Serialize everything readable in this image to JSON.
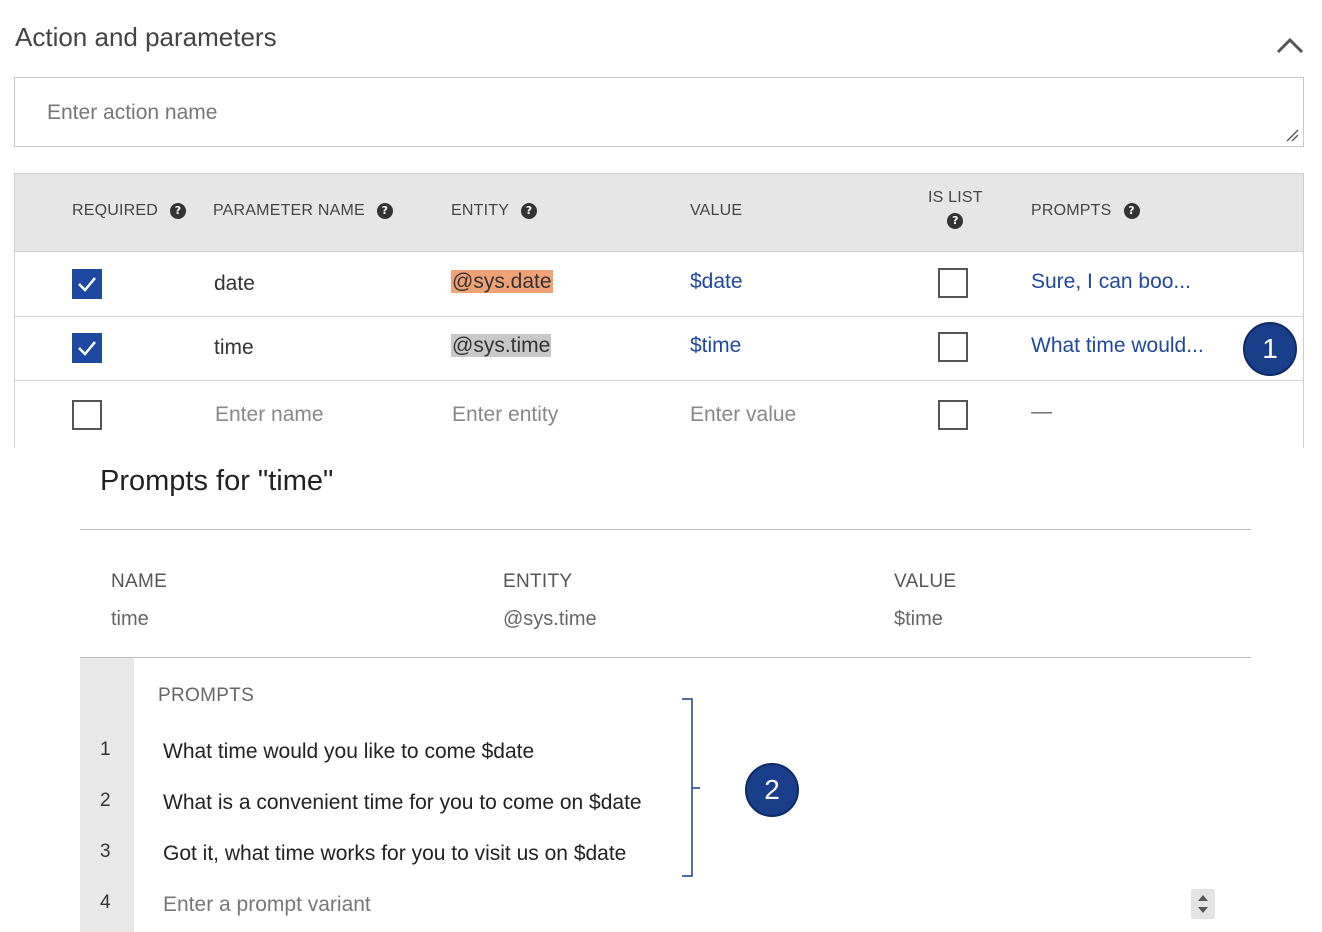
{
  "section": {
    "title": "Action and parameters",
    "collapse_icon": "chevron-up-icon"
  },
  "action_input": {
    "placeholder": "Enter action name"
  },
  "params_table": {
    "headers": {
      "required": "REQUIRED",
      "parameter_name": "PARAMETER NAME",
      "entity": "ENTITY",
      "value": "VALUE",
      "is_list_line1": "IS LIST",
      "prompts": "PROMPTS"
    },
    "help_icon": "?",
    "rows": [
      {
        "required": true,
        "name": "date",
        "entity": "@sys.date",
        "value": "$date",
        "is_list": false,
        "prompts": "Sure, I can boo..."
      },
      {
        "required": true,
        "name": "time",
        "entity": "@sys.time",
        "value": "$time",
        "is_list": false,
        "prompts": "What time would..."
      },
      {
        "required": false,
        "name": "Enter name",
        "entity": "Enter entity",
        "value": "Enter value",
        "is_list": false,
        "prompts": "—"
      }
    ]
  },
  "markers": {
    "one": "1",
    "two": "2"
  },
  "dialog": {
    "title": "Prompts for \"time\"",
    "meta_labels": {
      "name": "NAME",
      "entity": "ENTITY",
      "value": "VALUE"
    },
    "meta_values": {
      "name": "time",
      "entity": "@sys.time",
      "value": "$time"
    },
    "prompts_label": "PROMPTS",
    "prompts": [
      {
        "num": "1",
        "text": "What time would you like to come $date"
      },
      {
        "num": "2",
        "text": "What is a convenient time for you to come on $date"
      },
      {
        "num": "3",
        "text": "Got it, what time works for you to visit us on $date"
      },
      {
        "num": "4",
        "text": "Enter a prompt variant"
      }
    ]
  },
  "colors": {
    "accent": "#1e49a0",
    "marker": "#1a3f8a",
    "entity_date_highlight": "#f0a277",
    "entity_time_highlight": "#c8c8c8"
  }
}
